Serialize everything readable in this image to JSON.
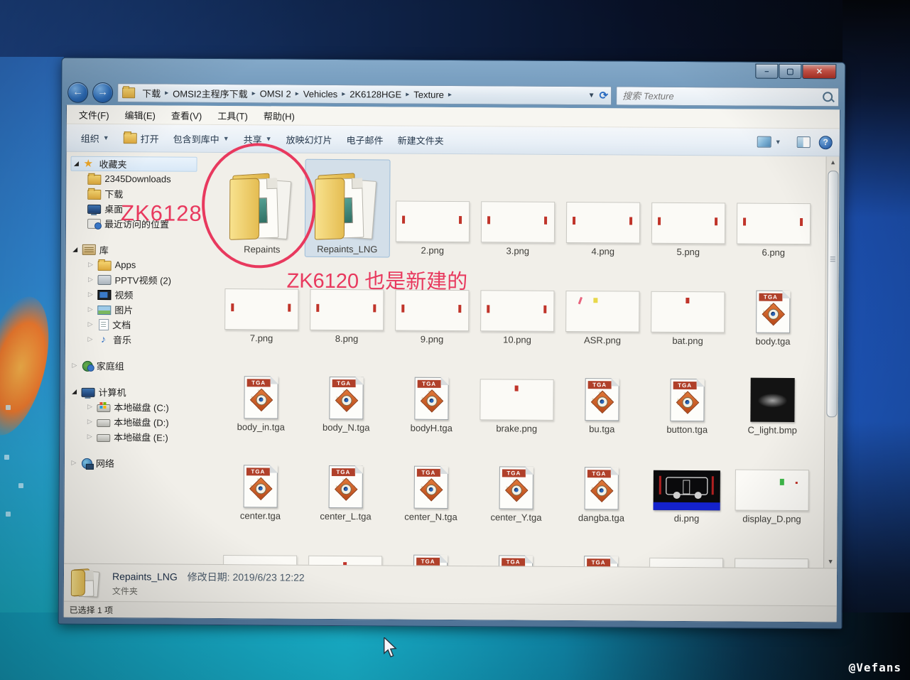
{
  "photo": {
    "watermark": "@Vefans"
  },
  "window": {
    "address": {
      "breadcrumb": [
        "下载",
        "OMSI2主程序下载",
        "OMSI 2",
        "Vehicles",
        "2K6128HGE",
        "Texture"
      ],
      "search_placeholder": "搜索 Texture"
    },
    "menu": [
      "文件(F)",
      "编辑(E)",
      "查看(V)",
      "工具(T)",
      "帮助(H)"
    ],
    "toolbar": [
      {
        "id": "organize",
        "label": "组织",
        "dropdown": true
      },
      {
        "id": "open",
        "label": "打开",
        "icon": "folder"
      },
      {
        "id": "include-in-library",
        "label": "包含到库中",
        "dropdown": true
      },
      {
        "id": "share",
        "label": "共享",
        "dropdown": true
      },
      {
        "id": "slideshow",
        "label": "放映幻灯片"
      },
      {
        "id": "email",
        "label": "电子邮件"
      },
      {
        "id": "new-folder",
        "label": "新建文件夹"
      }
    ],
    "sidebar": {
      "sections": [
        {
          "id": "favorites",
          "label": "收藏夹",
          "icon": "star",
          "expanded": true,
          "highlighted": true,
          "items": [
            {
              "id": "2345downloads",
              "label": "2345Downloads",
              "icon": "folder"
            },
            {
              "id": "downloads",
              "label": "下载",
              "icon": "folder"
            },
            {
              "id": "desktop",
              "label": "桌面",
              "icon": "desktop"
            },
            {
              "id": "recent-places",
              "label": "最近访问的位置",
              "icon": "recent"
            }
          ]
        },
        {
          "id": "libraries",
          "label": "库",
          "icon": "library",
          "expanded": true,
          "items": [
            {
              "id": "apps",
              "label": "Apps",
              "icon": "folder",
              "arrow": true
            },
            {
              "id": "pptv-videos",
              "label": "PPTV视频 (2)",
              "icon": "pptv",
              "arrow": true
            },
            {
              "id": "videos",
              "label": "视频",
              "icon": "videos",
              "arrow": true
            },
            {
              "id": "pictures",
              "label": "图片",
              "icon": "pictures",
              "arrow": true
            },
            {
              "id": "documents",
              "label": "文档",
              "icon": "documents",
              "arrow": true
            },
            {
              "id": "music",
              "label": "音乐",
              "icon": "music",
              "arrow": true
            }
          ]
        },
        {
          "id": "homegroup",
          "label": "家庭组",
          "icon": "homegroup",
          "expanded": false,
          "arrow": true,
          "items": []
        },
        {
          "id": "computer",
          "label": "计算机",
          "icon": "computer",
          "expanded": true,
          "items": [
            {
              "id": "disk-c",
              "label": "本地磁盘 (C:)",
              "icon": "disk-system",
              "arrow": true
            },
            {
              "id": "disk-d",
              "label": "本地磁盘 (D:)",
              "icon": "disk",
              "arrow": true
            },
            {
              "id": "disk-e",
              "label": "本地磁盘 (E:)",
              "icon": "disk",
              "arrow": true
            }
          ]
        },
        {
          "id": "network",
          "label": "网络",
          "icon": "network",
          "expanded": false,
          "arrow": true,
          "items": []
        }
      ]
    },
    "files": [
      {
        "name": "Repaints",
        "kind": "folder"
      },
      {
        "name": "Repaints_LNG",
        "kind": "folder",
        "selected": true
      },
      {
        "name": "2.png",
        "kind": "image-wide"
      },
      {
        "name": "3.png",
        "kind": "image-wide"
      },
      {
        "name": "4.png",
        "kind": "image-wide"
      },
      {
        "name": "5.png",
        "kind": "image-wide"
      },
      {
        "name": "6.png",
        "kind": "image-wide"
      },
      {
        "name": "7.png",
        "kind": "image-wide"
      },
      {
        "name": "8.png",
        "kind": "image-wide"
      },
      {
        "name": "9.png",
        "kind": "image-wide"
      },
      {
        "name": "10.png",
        "kind": "image-wide"
      },
      {
        "name": "ASR.png",
        "kind": "image-asr"
      },
      {
        "name": "bat.png",
        "kind": "image-dot"
      },
      {
        "name": "body.tga",
        "kind": "tga"
      },
      {
        "name": "body_in.tga",
        "kind": "tga"
      },
      {
        "name": "body_N.tga",
        "kind": "tga"
      },
      {
        "name": "bodyH.tga",
        "kind": "tga"
      },
      {
        "name": "brake.png",
        "kind": "image-dot"
      },
      {
        "name": "bu.tga",
        "kind": "tga"
      },
      {
        "name": "button.tga",
        "kind": "tga"
      },
      {
        "name": "C_light.bmp",
        "kind": "image-black"
      },
      {
        "name": "center.tga",
        "kind": "tga"
      },
      {
        "name": "center_L.tga",
        "kind": "tga"
      },
      {
        "name": "center_N.tga",
        "kind": "tga"
      },
      {
        "name": "center_Y.tga",
        "kind": "tga"
      },
      {
        "name": "dangba.tga",
        "kind": "tga"
      },
      {
        "name": "di.png",
        "kind": "image-bus"
      },
      {
        "name": "display_D.png",
        "kind": "image-display"
      },
      {
        "name": "",
        "kind": "image-plain"
      },
      {
        "name": "",
        "kind": "image-dot"
      },
      {
        "name": "",
        "kind": "tga"
      },
      {
        "name": "",
        "kind": "tga"
      },
      {
        "name": "",
        "kind": "tga"
      },
      {
        "name": "",
        "kind": "image-dot-yellow"
      },
      {
        "name": "",
        "kind": "image-dot-yellow"
      }
    ],
    "annotations": {
      "zk6128": "ZK6128",
      "zk6120": "ZK6120 也是新建的"
    },
    "details": {
      "name": "Repaints_LNG",
      "modified": "修改日期: 2019/6/23 12:22",
      "type": "文件夹"
    },
    "status": {
      "selection": "已选择 1 项"
    }
  }
}
